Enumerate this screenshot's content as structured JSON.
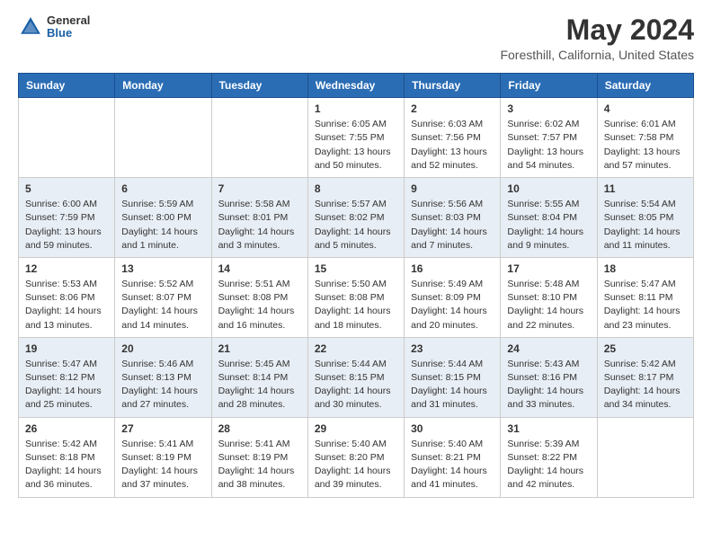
{
  "header": {
    "logo": {
      "general": "General",
      "blue": "Blue"
    },
    "title": "May 2024",
    "location": "Foresthill, California, United States"
  },
  "days_of_week": [
    "Sunday",
    "Monday",
    "Tuesday",
    "Wednesday",
    "Thursday",
    "Friday",
    "Saturday"
  ],
  "weeks": [
    [
      {
        "day": "",
        "info": ""
      },
      {
        "day": "",
        "info": ""
      },
      {
        "day": "",
        "info": ""
      },
      {
        "day": "1",
        "info": "Sunrise: 6:05 AM\nSunset: 7:55 PM\nDaylight: 13 hours\nand 50 minutes."
      },
      {
        "day": "2",
        "info": "Sunrise: 6:03 AM\nSunset: 7:56 PM\nDaylight: 13 hours\nand 52 minutes."
      },
      {
        "day": "3",
        "info": "Sunrise: 6:02 AM\nSunset: 7:57 PM\nDaylight: 13 hours\nand 54 minutes."
      },
      {
        "day": "4",
        "info": "Sunrise: 6:01 AM\nSunset: 7:58 PM\nDaylight: 13 hours\nand 57 minutes."
      }
    ],
    [
      {
        "day": "5",
        "info": "Sunrise: 6:00 AM\nSunset: 7:59 PM\nDaylight: 13 hours\nand 59 minutes."
      },
      {
        "day": "6",
        "info": "Sunrise: 5:59 AM\nSunset: 8:00 PM\nDaylight: 14 hours\nand 1 minute."
      },
      {
        "day": "7",
        "info": "Sunrise: 5:58 AM\nSunset: 8:01 PM\nDaylight: 14 hours\nand 3 minutes."
      },
      {
        "day": "8",
        "info": "Sunrise: 5:57 AM\nSunset: 8:02 PM\nDaylight: 14 hours\nand 5 minutes."
      },
      {
        "day": "9",
        "info": "Sunrise: 5:56 AM\nSunset: 8:03 PM\nDaylight: 14 hours\nand 7 minutes."
      },
      {
        "day": "10",
        "info": "Sunrise: 5:55 AM\nSunset: 8:04 PM\nDaylight: 14 hours\nand 9 minutes."
      },
      {
        "day": "11",
        "info": "Sunrise: 5:54 AM\nSunset: 8:05 PM\nDaylight: 14 hours\nand 11 minutes."
      }
    ],
    [
      {
        "day": "12",
        "info": "Sunrise: 5:53 AM\nSunset: 8:06 PM\nDaylight: 14 hours\nand 13 minutes."
      },
      {
        "day": "13",
        "info": "Sunrise: 5:52 AM\nSunset: 8:07 PM\nDaylight: 14 hours\nand 14 minutes."
      },
      {
        "day": "14",
        "info": "Sunrise: 5:51 AM\nSunset: 8:08 PM\nDaylight: 14 hours\nand 16 minutes."
      },
      {
        "day": "15",
        "info": "Sunrise: 5:50 AM\nSunset: 8:08 PM\nDaylight: 14 hours\nand 18 minutes."
      },
      {
        "day": "16",
        "info": "Sunrise: 5:49 AM\nSunset: 8:09 PM\nDaylight: 14 hours\nand 20 minutes."
      },
      {
        "day": "17",
        "info": "Sunrise: 5:48 AM\nSunset: 8:10 PM\nDaylight: 14 hours\nand 22 minutes."
      },
      {
        "day": "18",
        "info": "Sunrise: 5:47 AM\nSunset: 8:11 PM\nDaylight: 14 hours\nand 23 minutes."
      }
    ],
    [
      {
        "day": "19",
        "info": "Sunrise: 5:47 AM\nSunset: 8:12 PM\nDaylight: 14 hours\nand 25 minutes."
      },
      {
        "day": "20",
        "info": "Sunrise: 5:46 AM\nSunset: 8:13 PM\nDaylight: 14 hours\nand 27 minutes."
      },
      {
        "day": "21",
        "info": "Sunrise: 5:45 AM\nSunset: 8:14 PM\nDaylight: 14 hours\nand 28 minutes."
      },
      {
        "day": "22",
        "info": "Sunrise: 5:44 AM\nSunset: 8:15 PM\nDaylight: 14 hours\nand 30 minutes."
      },
      {
        "day": "23",
        "info": "Sunrise: 5:44 AM\nSunset: 8:15 PM\nDaylight: 14 hours\nand 31 minutes."
      },
      {
        "day": "24",
        "info": "Sunrise: 5:43 AM\nSunset: 8:16 PM\nDaylight: 14 hours\nand 33 minutes."
      },
      {
        "day": "25",
        "info": "Sunrise: 5:42 AM\nSunset: 8:17 PM\nDaylight: 14 hours\nand 34 minutes."
      }
    ],
    [
      {
        "day": "26",
        "info": "Sunrise: 5:42 AM\nSunset: 8:18 PM\nDaylight: 14 hours\nand 36 minutes."
      },
      {
        "day": "27",
        "info": "Sunrise: 5:41 AM\nSunset: 8:19 PM\nDaylight: 14 hours\nand 37 minutes."
      },
      {
        "day": "28",
        "info": "Sunrise: 5:41 AM\nSunset: 8:19 PM\nDaylight: 14 hours\nand 38 minutes."
      },
      {
        "day": "29",
        "info": "Sunrise: 5:40 AM\nSunset: 8:20 PM\nDaylight: 14 hours\nand 39 minutes."
      },
      {
        "day": "30",
        "info": "Sunrise: 5:40 AM\nSunset: 8:21 PM\nDaylight: 14 hours\nand 41 minutes."
      },
      {
        "day": "31",
        "info": "Sunrise: 5:39 AM\nSunset: 8:22 PM\nDaylight: 14 hours\nand 42 minutes."
      },
      {
        "day": "",
        "info": ""
      }
    ]
  ]
}
